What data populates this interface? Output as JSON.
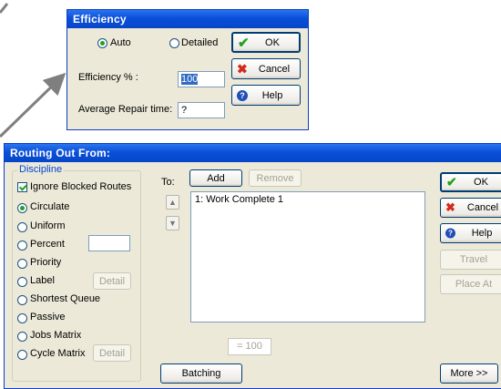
{
  "efficiency": {
    "title": "Efficiency",
    "mode_auto": "Auto",
    "mode_detailed": "Detailed",
    "efficiency_label": "Efficiency % :",
    "efficiency_value": "100",
    "repair_label": "Average Repair time:",
    "repair_value": "?",
    "ok": "OK",
    "cancel": "Cancel",
    "help": "Help"
  },
  "routing": {
    "title": "Routing Out From:",
    "discipline_title": "Discipline",
    "ignore_blocked": "Ignore Blocked Routes",
    "options": [
      "Circulate",
      "Uniform",
      "Percent",
      "Priority",
      "Label",
      "Shortest Queue",
      "Passive",
      "Jobs Matrix",
      "Cycle Matrix"
    ],
    "detail_label": "Detail",
    "detail_label_2": "Detail",
    "to_label": "To:",
    "add": "Add",
    "remove": "Remove",
    "list_items": [
      "1: Work Complete 1"
    ],
    "equals_value": "= 100",
    "batching": "Batching",
    "ok": "OK",
    "cancel": "Cancel",
    "help": "Help",
    "travel": "Travel",
    "place_at": "Place At",
    "more": "More >>"
  },
  "colors": {
    "titlebar": "#0a4fd9",
    "group_title": "#0046d5",
    "check_green": "#21a121",
    "cancel_red": "#d32a1e",
    "help_blue": "#1e4fb8"
  }
}
